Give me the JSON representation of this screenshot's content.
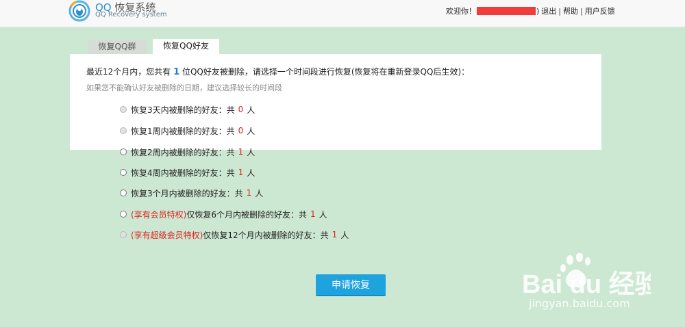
{
  "header": {
    "logo_title_1": "QQ",
    "logo_title_2": "恢复系统",
    "logo_subtitle": "QQ Recovery system",
    "welcome": "欢迎你！",
    "user_suffix": ")",
    "logout": "退出",
    "help": "帮助",
    "feedback": "用户反馈",
    "separator": "|"
  },
  "tabs": [
    {
      "label": "恢复QQ群"
    },
    {
      "label": "恢复QQ好友"
    }
  ],
  "intro": {
    "prefix": "最近12个月内，您共有",
    "count": "1",
    "suffix": "位QQ好友被删除，请选择一个时间段进行恢复(恢复将在重新登录QQ后生效)："
  },
  "hint": "如果您不能确认好友被删除的日期，建议选择较长的时间段",
  "options": [
    {
      "tag": "",
      "label": "恢复3天内被删除的好友：共",
      "count": "0",
      "unit": "人",
      "enabled": false
    },
    {
      "tag": "",
      "label": "恢复1周内被删除的好友：共",
      "count": "0",
      "unit": "人",
      "enabled": false
    },
    {
      "tag": "",
      "label": "恢复2周内被删除的好友：共",
      "count": "1",
      "unit": "人",
      "enabled": true
    },
    {
      "tag": "",
      "label": "恢复4周内被删除的好友：共",
      "count": "1",
      "unit": "人",
      "enabled": true
    },
    {
      "tag": "",
      "label": "恢复3个月内被删除的好友：共",
      "count": "1",
      "unit": "人",
      "enabled": true
    },
    {
      "tag": "(享有会员特权)",
      "label": "仅恢复6个月内被删除的好友：共",
      "count": "1",
      "unit": "人",
      "enabled": true
    },
    {
      "tag": "(享有超级会员特权)",
      "label": "仅恢复12个月内被删除的好友：共",
      "count": "1",
      "unit": "人",
      "enabled": false
    }
  ],
  "submit_label": "申请恢复",
  "watermark": {
    "brand": "Bai du 经验",
    "url": "jingyan.baidu.com"
  },
  "colors": {
    "background": "#cde8d2",
    "accent_blue": "#1fa3df",
    "count_red": "#e02020",
    "redaction": "#f23b3b"
  }
}
